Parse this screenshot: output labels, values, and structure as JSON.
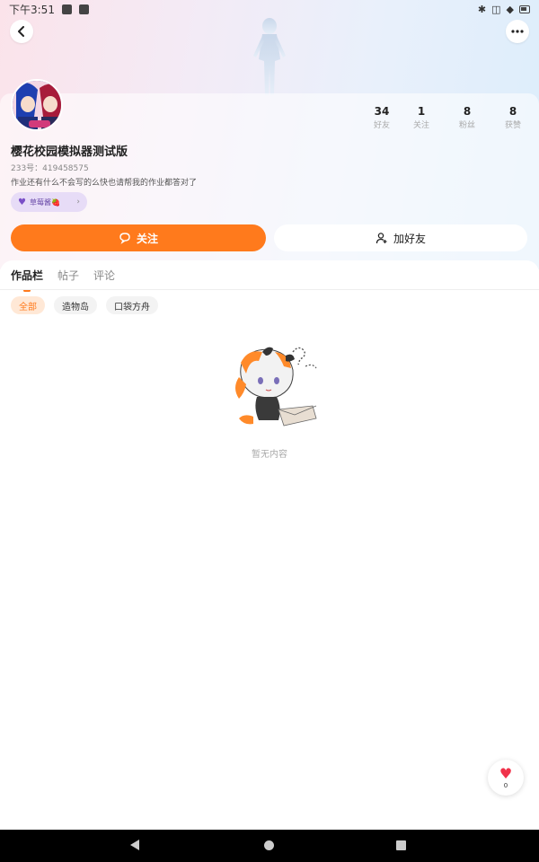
{
  "status_bar": {
    "time": "下午3:51"
  },
  "header": {
    "back_icon": "chevron-left-icon",
    "more_icon": "more-horizontal-icon"
  },
  "profile": {
    "username": "樱花校园模拟器测试版",
    "uid": "233号：419458575",
    "bio": "作业还有什么不会写的么快也请帮我的作业都答对了",
    "badge_label": "草莓酱🍓"
  },
  "stats": [
    {
      "value": "34",
      "label": "好友"
    },
    {
      "value": "1",
      "label": "关注"
    },
    {
      "value": "8",
      "label": "粉丝"
    },
    {
      "value": "8",
      "label": "获赞"
    }
  ],
  "actions": {
    "follow_label": "关注",
    "add_friend_label": "加好友"
  },
  "tabs": [
    {
      "label": "作品栏",
      "active": true
    },
    {
      "label": "帖子",
      "active": false
    },
    {
      "label": "评论",
      "active": false
    }
  ],
  "chips": [
    {
      "label": "全部",
      "active": true
    },
    {
      "label": "造物岛",
      "active": false
    },
    {
      "label": "口袋方舟",
      "active": false
    }
  ],
  "empty_state": {
    "text": "暂无内容"
  },
  "like": {
    "count": "0"
  },
  "colors": {
    "accent": "#ff7a1c",
    "like": "#f0324a",
    "badge_bg": "#e7dcf7"
  }
}
